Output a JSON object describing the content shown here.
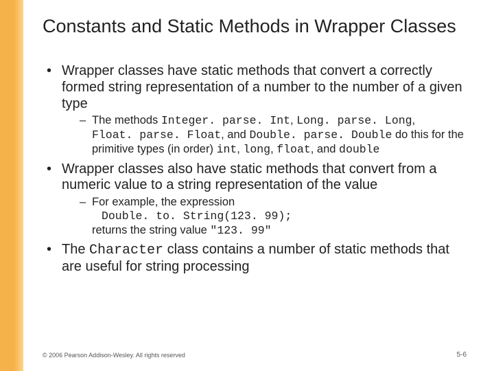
{
  "title": "Constants and Static Methods in Wrapper Classes",
  "b1": {
    "text": "Wrapper classes have static methods that convert a correctly formed string representation of a number to the number of a given type",
    "s_pre": "The methods ",
    "m1": "Integer. parse. Int",
    "c1": ", ",
    "m2": "Long. parse. Long",
    "c2": ", ",
    "m3": "Float. parse. Float",
    "c3": ", and ",
    "m4": "Double. parse. Double",
    "mid": " do this for the primitive types (in order) ",
    "p1": "int",
    "pc1": ", ",
    "p2": "long",
    "pc2": ", ",
    "p3": "float",
    "pc3": ", and ",
    "p4": "double"
  },
  "b2": {
    "text": "Wrapper classes also have static methods that convert from a numeric value to a string representation of the value",
    "s_l1": "For example, the expression",
    "s_code": "Double. to. String(123. 99);",
    "s_l3a": "returns the string value ",
    "s_l3b": "\"123. 99\""
  },
  "b3": {
    "pre": "The ",
    "cls": "Character",
    "post": " class contains a number of static methods that are useful for string processing"
  },
  "footer": {
    "copyright": "© 2006 Pearson Addison-Wesley. All rights reserved",
    "page": "5-6"
  }
}
